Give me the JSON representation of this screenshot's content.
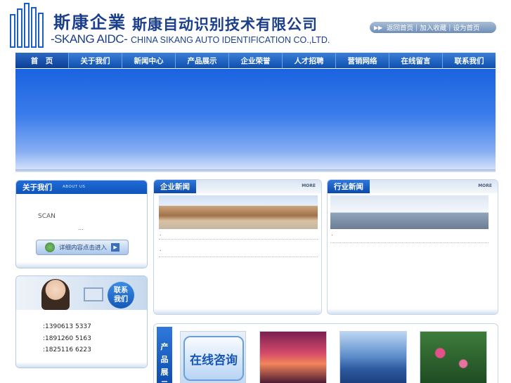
{
  "header": {
    "logo_cn": "斯康企業",
    "logo_en": "-SKANG AIDC-",
    "company_cn": "斯康自动识别技术有限公司",
    "company_en": "CHINA SIKANG AUTO IDENTIFICATION CO.,LTD.",
    "toplinks": [
      "返回首页",
      "加入收藏",
      "设为首页"
    ]
  },
  "nav": {
    "items": [
      "首　页",
      "关于我们",
      "新闻中心",
      "产品展示",
      "企业荣誉",
      "人才招聘",
      "营销网络",
      "在线留言",
      "联系我们"
    ]
  },
  "about": {
    "title": "关于我们",
    "subtitle": "ABOUT US",
    "text": "SCAN",
    "dots": "...",
    "button": "详细内容点击进入"
  },
  "contact": {
    "badge_line1": "联系",
    "badge_line2": "我们",
    "phones": [
      ":1390613 5337",
      ":1891260 5163",
      ":1825116 6223"
    ]
  },
  "news": {
    "company_title": "企业新闻",
    "industry_title": "行业新闻",
    "more": "MORE",
    "dot": "."
  },
  "products": {
    "label": [
      "产",
      "品",
      "展",
      "示"
    ],
    "consult": "在线咨询"
  },
  "colors": {
    "nav_blue": "#0d4fae",
    "brand_text": "#1b3f8c",
    "banner_top": "#1a63e0"
  }
}
